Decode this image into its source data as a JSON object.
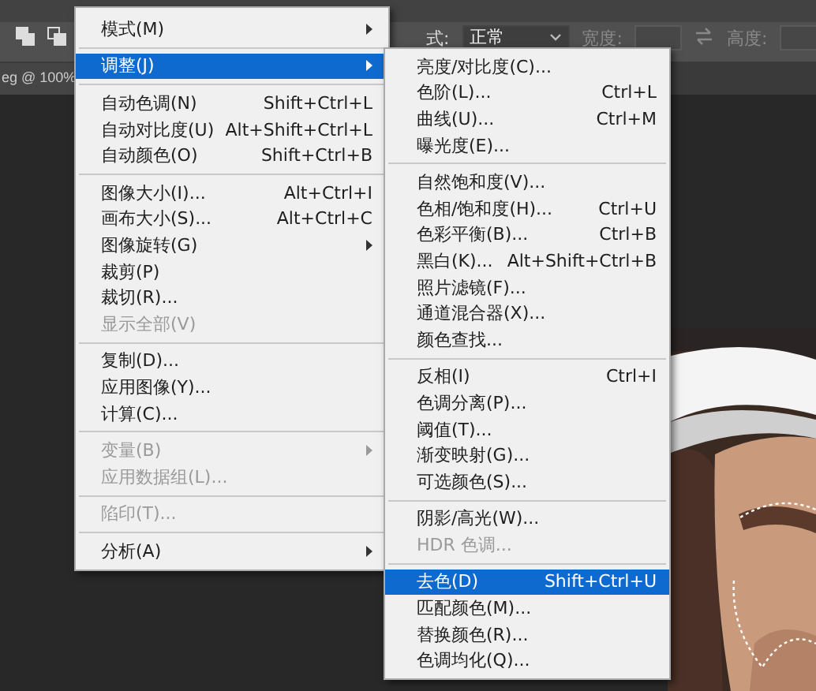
{
  "options_bar": {
    "style_label": "式:",
    "style_value": "正常",
    "width_label": "宽度:",
    "height_label": "高度:"
  },
  "document_tab": {
    "title": "eg @ 100%"
  },
  "image_menu": {
    "items": [
      {
        "kind": "item",
        "label": "模式(M)",
        "submenu": true,
        "disabled": false,
        "selected": false
      },
      {
        "kind": "separator"
      },
      {
        "kind": "item",
        "label": "调整(J)",
        "submenu": true,
        "disabled": false,
        "selected": true
      },
      {
        "kind": "separator"
      },
      {
        "kind": "item",
        "label": "自动色调(N)",
        "shortcut": "Shift+Ctrl+L",
        "submenu": false,
        "disabled": false,
        "selected": false
      },
      {
        "kind": "item",
        "label": "自动对比度(U)",
        "shortcut": "Alt+Shift+Ctrl+L",
        "submenu": false,
        "disabled": false,
        "selected": false
      },
      {
        "kind": "item",
        "label": "自动颜色(O)",
        "shortcut": "Shift+Ctrl+B",
        "submenu": false,
        "disabled": false,
        "selected": false
      },
      {
        "kind": "separator"
      },
      {
        "kind": "item",
        "label": "图像大小(I)...",
        "shortcut": "Alt+Ctrl+I",
        "submenu": false,
        "disabled": false,
        "selected": false
      },
      {
        "kind": "item",
        "label": "画布大小(S)...",
        "shortcut": "Alt+Ctrl+C",
        "submenu": false,
        "disabled": false,
        "selected": false
      },
      {
        "kind": "item",
        "label": "图像旋转(G)",
        "submenu": true,
        "disabled": false,
        "selected": false
      },
      {
        "kind": "item",
        "label": "裁剪(P)",
        "submenu": false,
        "disabled": false,
        "selected": false
      },
      {
        "kind": "item",
        "label": "裁切(R)...",
        "submenu": false,
        "disabled": false,
        "selected": false
      },
      {
        "kind": "item",
        "label": "显示全部(V)",
        "submenu": false,
        "disabled": true,
        "selected": false
      },
      {
        "kind": "separator"
      },
      {
        "kind": "item",
        "label": "复制(D)...",
        "submenu": false,
        "disabled": false,
        "selected": false
      },
      {
        "kind": "item",
        "label": "应用图像(Y)...",
        "submenu": false,
        "disabled": false,
        "selected": false
      },
      {
        "kind": "item",
        "label": "计算(C)...",
        "submenu": false,
        "disabled": false,
        "selected": false
      },
      {
        "kind": "separator"
      },
      {
        "kind": "item",
        "label": "变量(B)",
        "submenu": true,
        "disabled": true,
        "selected": false
      },
      {
        "kind": "item",
        "label": "应用数据组(L)...",
        "submenu": false,
        "disabled": true,
        "selected": false
      },
      {
        "kind": "separator"
      },
      {
        "kind": "item",
        "label": "陷印(T)...",
        "submenu": false,
        "disabled": true,
        "selected": false
      },
      {
        "kind": "separator"
      },
      {
        "kind": "item",
        "label": "分析(A)",
        "submenu": true,
        "disabled": false,
        "selected": false
      }
    ]
  },
  "adjustments_submenu": {
    "items": [
      {
        "kind": "item",
        "label": "亮度/对比度(C)...",
        "disabled": false,
        "selected": false
      },
      {
        "kind": "item",
        "label": "色阶(L)...",
        "shortcut": "Ctrl+L",
        "disabled": false,
        "selected": false
      },
      {
        "kind": "item",
        "label": "曲线(U)...",
        "shortcut": "Ctrl+M",
        "disabled": false,
        "selected": false
      },
      {
        "kind": "item",
        "label": "曝光度(E)...",
        "disabled": false,
        "selected": false
      },
      {
        "kind": "separator"
      },
      {
        "kind": "item",
        "label": "自然饱和度(V)...",
        "disabled": false,
        "selected": false
      },
      {
        "kind": "item",
        "label": "色相/饱和度(H)...",
        "shortcut": "Ctrl+U",
        "disabled": false,
        "selected": false
      },
      {
        "kind": "item",
        "label": "色彩平衡(B)...",
        "shortcut": "Ctrl+B",
        "disabled": false,
        "selected": false
      },
      {
        "kind": "item",
        "label": "黑白(K)...",
        "shortcut": "Alt+Shift+Ctrl+B",
        "disabled": false,
        "selected": false
      },
      {
        "kind": "item",
        "label": "照片滤镜(F)...",
        "disabled": false,
        "selected": false
      },
      {
        "kind": "item",
        "label": "通道混合器(X)...",
        "disabled": false,
        "selected": false
      },
      {
        "kind": "item",
        "label": "颜色查找...",
        "disabled": false,
        "selected": false
      },
      {
        "kind": "separator"
      },
      {
        "kind": "item",
        "label": "反相(I)",
        "shortcut": "Ctrl+I",
        "disabled": false,
        "selected": false
      },
      {
        "kind": "item",
        "label": "色调分离(P)...",
        "disabled": false,
        "selected": false
      },
      {
        "kind": "item",
        "label": "阈值(T)...",
        "disabled": false,
        "selected": false
      },
      {
        "kind": "item",
        "label": "渐变映射(G)...",
        "disabled": false,
        "selected": false
      },
      {
        "kind": "item",
        "label": "可选颜色(S)...",
        "disabled": false,
        "selected": false
      },
      {
        "kind": "separator"
      },
      {
        "kind": "item",
        "label": "阴影/高光(W)...",
        "disabled": false,
        "selected": false
      },
      {
        "kind": "item",
        "label": "HDR 色调...",
        "disabled": true,
        "selected": false
      },
      {
        "kind": "separator"
      },
      {
        "kind": "item",
        "label": "去色(D)",
        "shortcut": "Shift+Ctrl+U",
        "disabled": false,
        "selected": true
      },
      {
        "kind": "item",
        "label": "匹配颜色(M)...",
        "disabled": false,
        "selected": false
      },
      {
        "kind": "item",
        "label": "替换颜色(R)...",
        "disabled": false,
        "selected": false
      },
      {
        "kind": "item",
        "label": "色调均化(Q)...",
        "disabled": false,
        "selected": false
      }
    ]
  }
}
